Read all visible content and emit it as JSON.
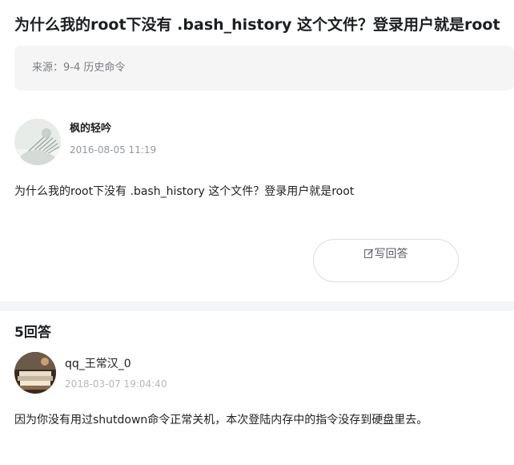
{
  "question": {
    "title": "为什么我的root下没有 .bash_history 这个文件？登录用户就是root",
    "source": "来源：9-4 历史命令",
    "author": "枫的轻吟",
    "date": "2016-08-05 11:19",
    "body": "为什么我的root下没有 .bash_history 这个文件？登录用户就是root",
    "answer_button_label": "写回答",
    "answer_button_icon": "edit-pen-icon"
  },
  "answers": {
    "count_label": "5回答",
    "items": [
      {
        "author": "qq_王常汉_0",
        "date": "2018-03-07 19:04:40",
        "body": "因为你没有用过shutdown命令正常关机，本次登陆内存中的指令没存到硬盘里去。"
      }
    ]
  },
  "colors": {
    "text": "#1c1f21",
    "muted": "#93999f",
    "source_bg": "#f5f5f5",
    "divider": "#f3f5f6",
    "button_border": "#d9dde1"
  }
}
